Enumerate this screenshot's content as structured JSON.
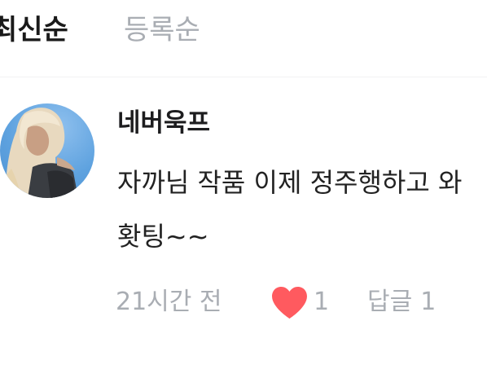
{
  "sort_tabs": [
    {
      "label": "최신순",
      "active": true
    },
    {
      "label": "등록순",
      "active": false
    }
  ],
  "comment": {
    "author": "네버욱프",
    "avatar_icon": "profile-photo",
    "text_lines": [
      "자까님 작품 이제 정주행하고 와",
      "홧팅~~"
    ],
    "timestamp": "21시간 전",
    "like_icon": "heart-icon",
    "like_color": "#ff5a5f",
    "like_count": "1",
    "reply_label": "답글",
    "reply_count": "1"
  },
  "colors": {
    "text_primary": "#1a1a1a",
    "text_muted": "#a9adb3",
    "divider": "#f1f1f3",
    "like": "#ff5a5f"
  }
}
